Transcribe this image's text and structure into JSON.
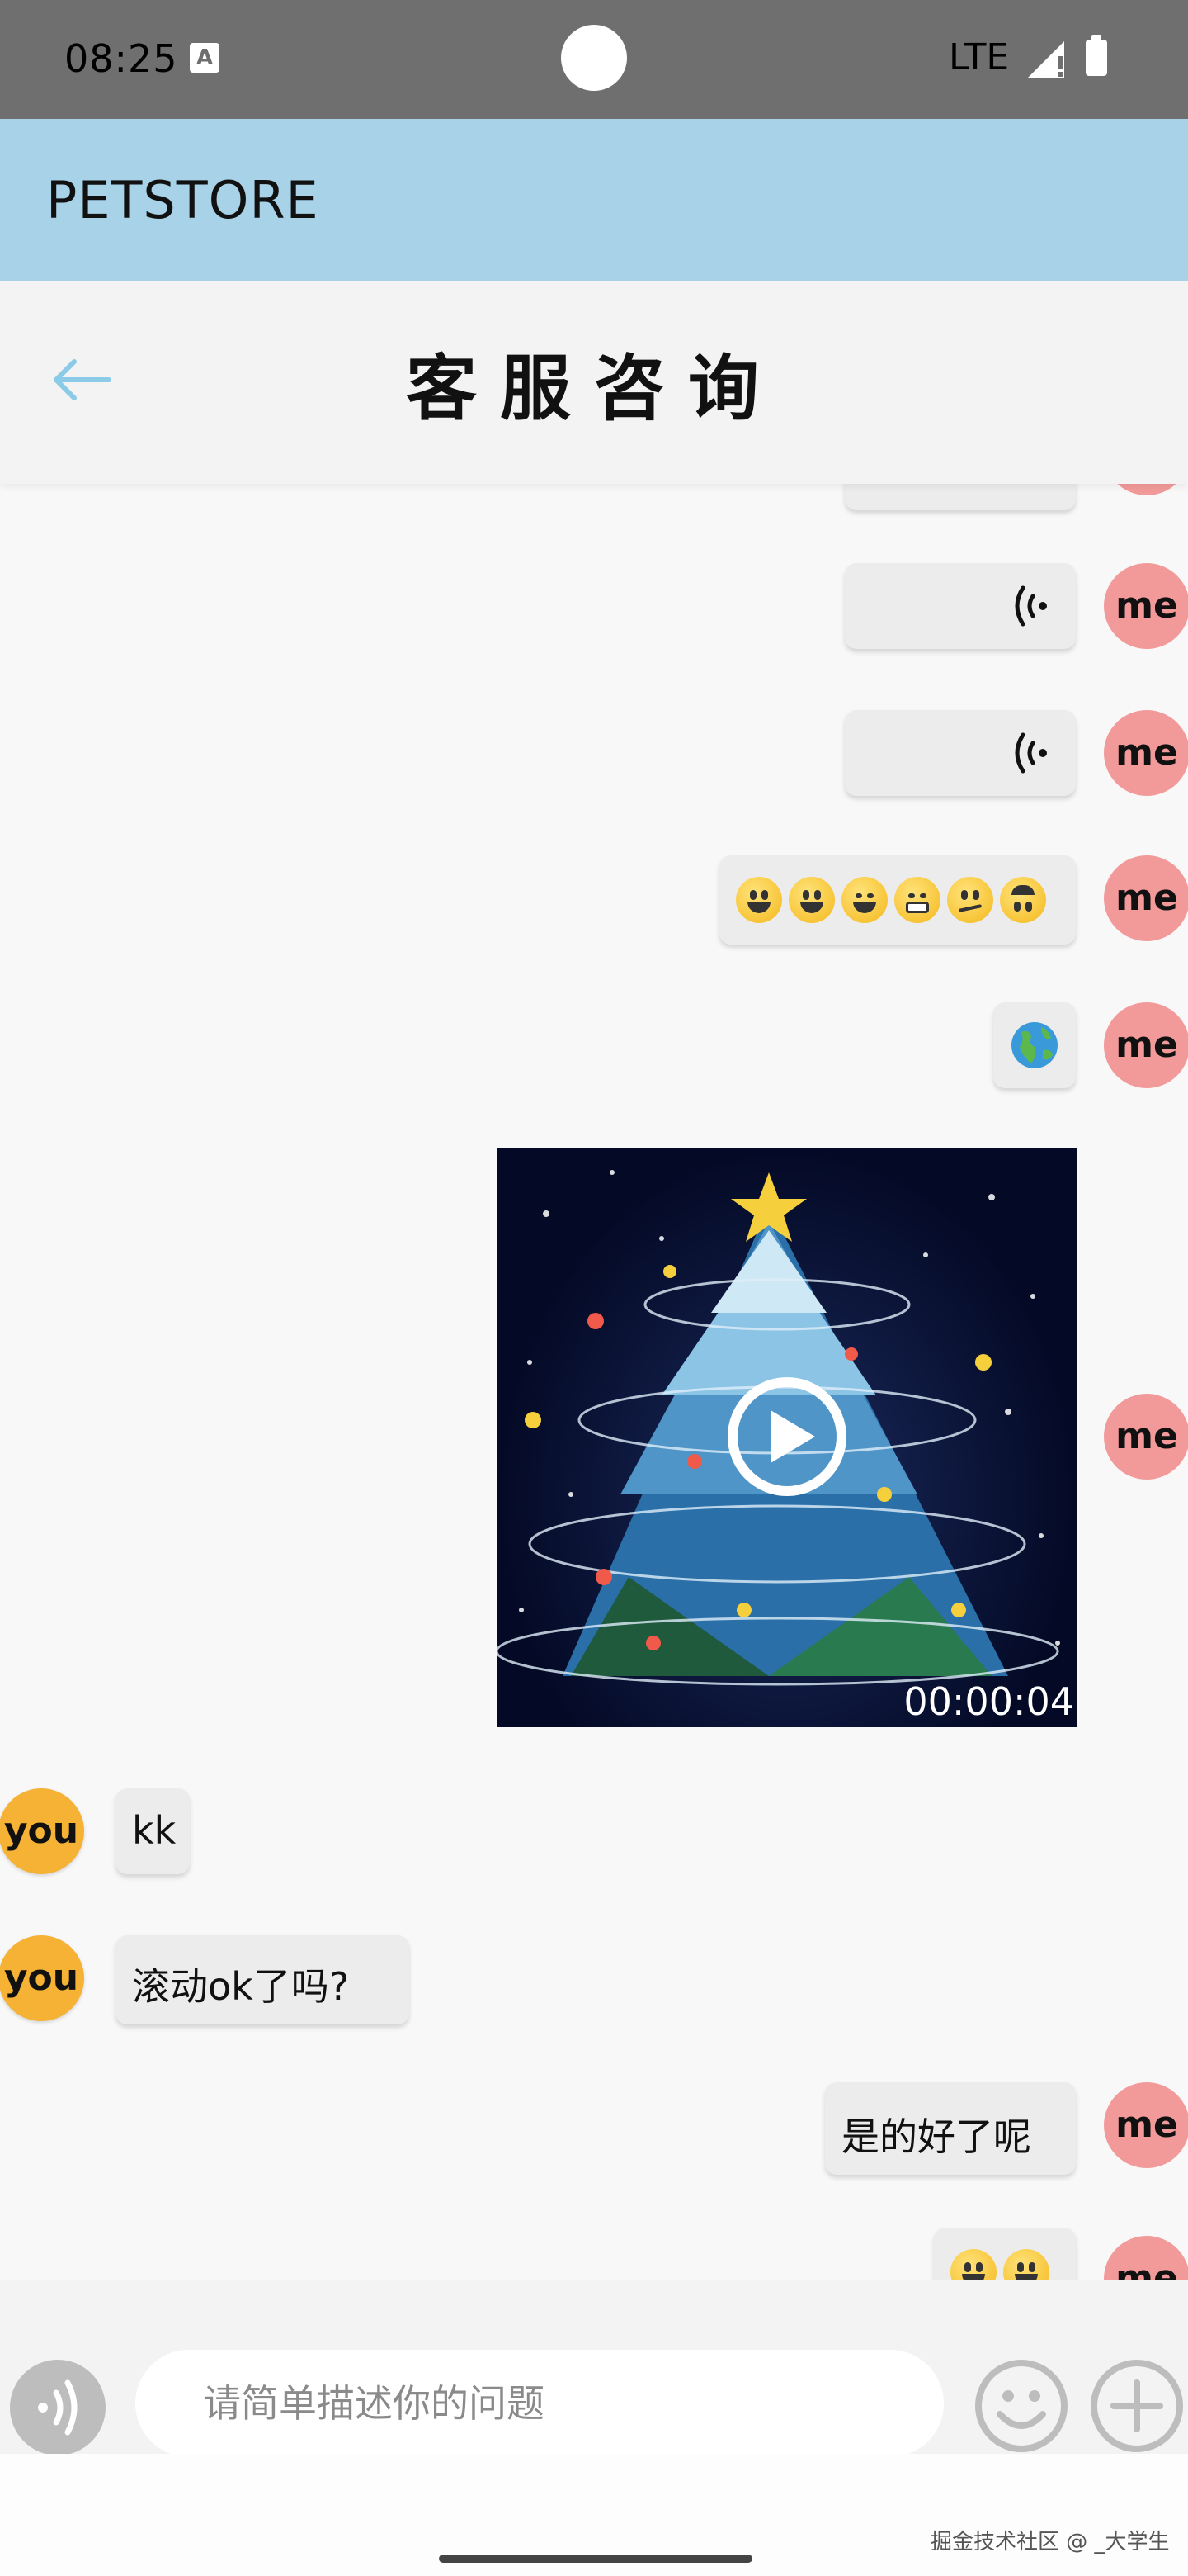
{
  "status_bar": {
    "time": "08:25",
    "network": "LTE"
  },
  "app_bar": {
    "title": "PETSTORE"
  },
  "header": {
    "title": "客服咨询"
  },
  "avatars": {
    "me": "me",
    "you": "you"
  },
  "messages": [
    {
      "from": "me",
      "type": "voice"
    },
    {
      "from": "me",
      "type": "voice"
    },
    {
      "from": "me",
      "type": "voice"
    },
    {
      "from": "me",
      "type": "emoji",
      "emojis": [
        "grinning",
        "smiley",
        "smile",
        "grin",
        "confused",
        "upside-down"
      ]
    },
    {
      "from": "me",
      "type": "emoji",
      "emojis": [
        "earth-globe"
      ]
    },
    {
      "from": "me",
      "type": "video",
      "duration": "00:00:04"
    },
    {
      "from": "you",
      "type": "text",
      "text": "kk"
    },
    {
      "from": "you",
      "type": "text",
      "text": "滚动ok了吗?"
    },
    {
      "from": "me",
      "type": "text",
      "text": "是的好了呢"
    },
    {
      "from": "me",
      "type": "emoji",
      "emojis": [
        "grinning",
        "smiley"
      ]
    }
  ],
  "input": {
    "placeholder": "请简单描述你的问题"
  },
  "watermark": "掘金技术社区 @ _大学生",
  "colors": {
    "app_bar": "#a8d2e8",
    "me_avatar": "#f29a9a",
    "you_avatar": "#f5b235",
    "back_arrow": "#8ccbe8"
  }
}
